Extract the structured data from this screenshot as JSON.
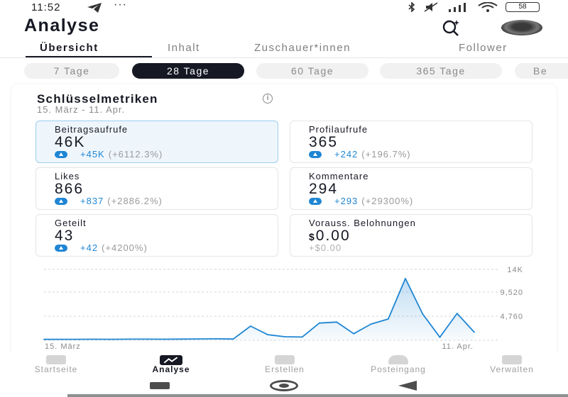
{
  "status_bar": {
    "time": "11:52",
    "dots": "···",
    "battery": "58"
  },
  "header": {
    "title": "Analyse"
  },
  "tabs": [
    {
      "label": "Übersicht",
      "active": true
    },
    {
      "label": "Inhalt",
      "active": false
    },
    {
      "label": "Zuschauer*innen",
      "active": false
    },
    {
      "label": "Follower",
      "active": false
    }
  ],
  "periods": [
    {
      "label": "7 Tage",
      "active": false
    },
    {
      "label": "28 Tage",
      "active": true
    },
    {
      "label": "60 Tage",
      "active": false
    },
    {
      "label": "365 Tage",
      "active": false
    },
    {
      "label": "Be",
      "active": false
    }
  ],
  "metrics_card": {
    "title": "Schlüsselmetriken",
    "date_range": "15. März - 11. Apr.",
    "metrics": [
      {
        "label": "Beitragsaufrufe",
        "value": "46K",
        "delta": "+45K",
        "pct": "(+6112.3%)",
        "selected": true
      },
      {
        "label": "Profilaufrufe",
        "value": "365",
        "delta": "+242",
        "pct": "(+196.7%)"
      },
      {
        "label": "Likes",
        "value": "866",
        "delta": "+837",
        "pct": "(+2886.2%)"
      },
      {
        "label": "Kommentare",
        "value": "294",
        "delta": "+293",
        "pct": "(+29300%)"
      },
      {
        "label": "Geteilt",
        "value": "43",
        "delta": "+42",
        "pct": "(+4200%)"
      },
      {
        "label": "Vorauss. Belohnungen",
        "currency": "$",
        "value": "0.00",
        "sub": "+$0.00"
      }
    ]
  },
  "chart_data": {
    "type": "area",
    "x_start_label": "15. März",
    "x_end_label": "11. Apr.",
    "y_tick_labels": [
      "14K",
      "9,520",
      "4,760"
    ],
    "y_ticks": [
      14000,
      9520,
      4760
    ],
    "ylim": [
      0,
      14000
    ],
    "grid": true,
    "color": "#1f86d3",
    "values": [
      180,
      200,
      190,
      210,
      200,
      220,
      230,
      210,
      240,
      260,
      300,
      250,
      2800,
      1100,
      700,
      650,
      3400,
      3600,
      1300,
      3200,
      4200,
      12200,
      5200,
      600,
      5300,
      1600
    ]
  },
  "bottom_nav": [
    {
      "label": "Startseite",
      "icon": "home-icon",
      "active": false
    },
    {
      "label": "Analyse",
      "icon": "analytics-icon",
      "active": true
    },
    {
      "label": "Erstellen",
      "icon": "create-icon",
      "active": false
    },
    {
      "label": "Posteingang",
      "icon": "inbox-icon",
      "active": false
    },
    {
      "label": "Verwalten",
      "icon": "manage-icon",
      "active": false
    }
  ]
}
